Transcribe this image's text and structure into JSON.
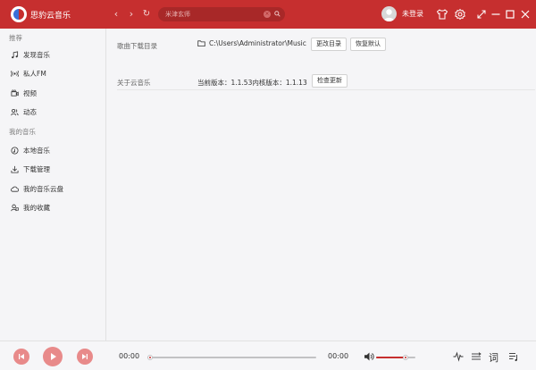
{
  "app": {
    "title": "思豹云音乐"
  },
  "nav": {
    "back": "‹",
    "forward": "›",
    "refresh": "↻"
  },
  "search": {
    "placeholder": "米津玄师",
    "clear": "×"
  },
  "user": {
    "login_label": "未登录"
  },
  "colors": {
    "brand": "#c62f2f",
    "sidebar_bg": "#f5f5f7",
    "text": "#333333"
  },
  "sidebar": {
    "sections": [
      {
        "title": "推荐",
        "items": [
          {
            "label": "发现音乐",
            "icon": "music-note-icon"
          },
          {
            "label": "私人FM",
            "icon": "radio-icon"
          },
          {
            "label": "视频",
            "icon": "video-icon"
          },
          {
            "label": "动态",
            "icon": "friends-icon"
          }
        ]
      },
      {
        "title": "我的音乐",
        "items": [
          {
            "label": "本地音乐",
            "icon": "disc-icon"
          },
          {
            "label": "下载管理",
            "icon": "download-icon"
          },
          {
            "label": "我的音乐云盘",
            "icon": "cloud-icon"
          },
          {
            "label": "我的收藏",
            "icon": "collect-icon"
          }
        ]
      }
    ]
  },
  "settings": {
    "download_dir": {
      "label": "歌曲下载目录",
      "path": "C:\\Users\\Administrator\\Music",
      "change_button": "更改目录",
      "reset_button": "恢复默认"
    },
    "about": {
      "label": "关于云音乐",
      "version_text": "当前版本：1.1.53内核版本：1.1.13",
      "check_button": "检查更新"
    }
  },
  "player": {
    "current_time": "00:00",
    "total_time": "00:00",
    "progress": 0,
    "volume": 0.75,
    "lyric_label": "词"
  }
}
